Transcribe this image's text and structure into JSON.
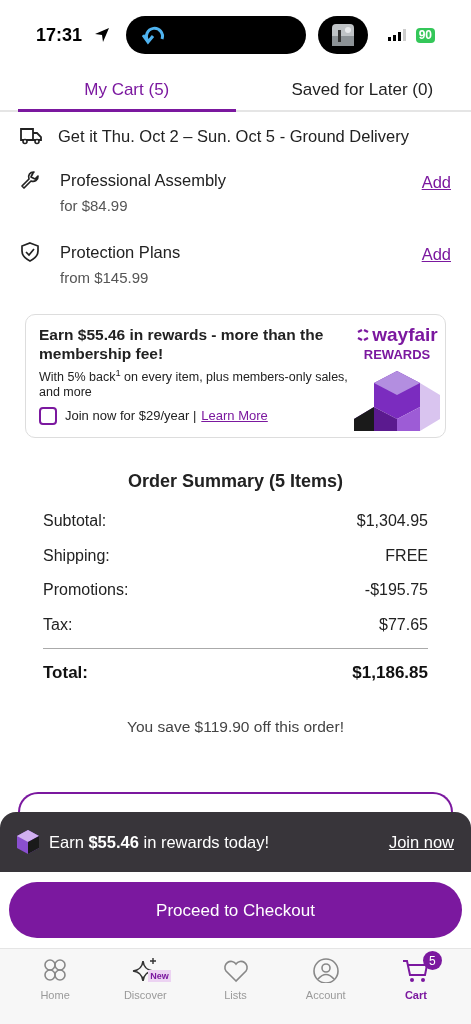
{
  "status_bar": {
    "time": "17:31",
    "battery": "90"
  },
  "tabs": [
    {
      "label": "My Cart (5)",
      "selected": true
    },
    {
      "label": "Saved for Later (0)",
      "selected": false
    }
  ],
  "delivery": {
    "text": "Get it Thu. Oct 2 – Sun. Oct 5 - Ground Delivery"
  },
  "services": [
    {
      "kind": "assembly",
      "title": "Professional Assembly",
      "price": "for $84.99",
      "action": "Add"
    },
    {
      "kind": "protection",
      "title": "Protection Plans",
      "price": "from $145.99",
      "action": "Add"
    }
  ],
  "rewards_card": {
    "headline": "Earn $55.46 in rewards - more than the membership fee!",
    "body": "With 5% back$^{1}$ on every item, plus members-only sales, and more",
    "join_label": "Join now for $29/year |",
    "checked": false,
    "link": "Learn More",
    "brand": "wayfair",
    "brand_sub": "REWARDS"
  },
  "order_summary": {
    "title": "Order Summary (5 Items)",
    "rows": [
      {
        "label": "Subtotal:",
        "value": "$1,304.95"
      },
      {
        "label": "Shipping:",
        "value": "FREE"
      },
      {
        "label": "Promotions:",
        "value": "-$195.75"
      },
      {
        "label": "Tax:",
        "value": "$77.65"
      }
    ],
    "total_label": "Total:",
    "total_value": "$1,186.85",
    "savings": "You save $119.90 off this order!"
  },
  "rewards_banner": {
    "text": "Earn **$55.46** in rewards today!",
    "link": "Join now"
  },
  "checkout_button": "Proceed to Checkout",
  "bottom_nav": [
    {
      "kind": "home",
      "label": "Home",
      "selected": false
    },
    {
      "kind": "discover",
      "label": "Discover",
      "badge": "New",
      "selected": false
    },
    {
      "kind": "lists",
      "label": "Lists",
      "selected": false
    },
    {
      "kind": "account",
      "label": "Account",
      "selected": false
    },
    {
      "kind": "cart",
      "label": "Cart",
      "badge": "5",
      "selected": true
    }
  ]
}
